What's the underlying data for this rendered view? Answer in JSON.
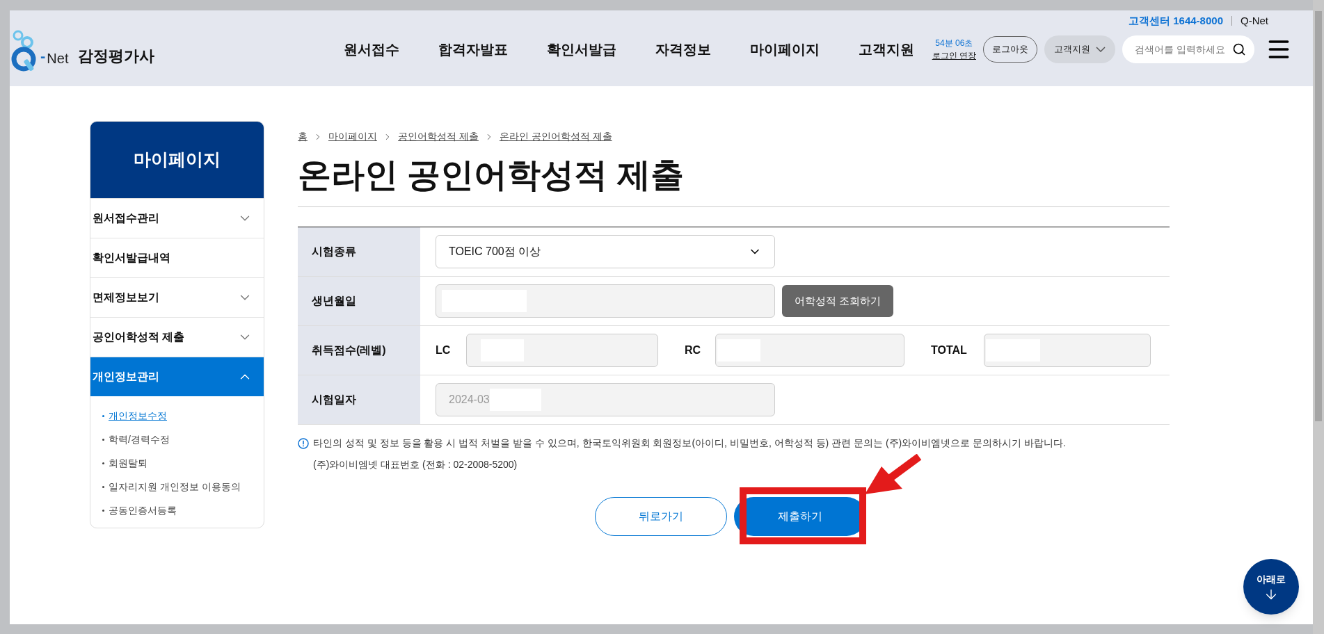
{
  "header": {
    "site_name": "감정평가사",
    "logo_text": "Net",
    "logo_dash": "-",
    "top_links": [
      {
        "label": "고객센터 1644-8000",
        "kind": "phone"
      },
      {
        "label": "Q-Net",
        "kind": "link"
      }
    ],
    "nav": [
      "원서접수",
      "합격자발표",
      "확인서발급",
      "자격정보",
      "마이페이지",
      "고객지원"
    ],
    "session": {
      "remaining": "54분 06초",
      "extend": "로그인 연장"
    },
    "logout": "로그아웃",
    "support_dropdown": "고객지원",
    "search": {
      "placeholder": "검색어를 입력하세요"
    }
  },
  "sidebar": {
    "title": "마이페이지",
    "items": [
      {
        "label": "원서접수관리",
        "kind": "group",
        "expanded": false
      },
      {
        "label": "확인서발급내역",
        "kind": "link",
        "expanded": false
      },
      {
        "label": "면제정보보기",
        "kind": "group",
        "expanded": false
      },
      {
        "label": "공인어학성적 제출",
        "kind": "group",
        "expanded": false
      },
      {
        "label": "개인정보관리",
        "kind": "group",
        "expanded": true,
        "children": [
          {
            "label": "개인정보수정",
            "selected": true
          },
          {
            "label": "학력/경력수정",
            "selected": false
          },
          {
            "label": "회원탈퇴",
            "selected": false
          },
          {
            "label": "일자리지원 개인정보 이용동의",
            "selected": false
          },
          {
            "label": "공동인증서등록",
            "selected": false
          }
        ]
      }
    ]
  },
  "breadcrumb": [
    "홈",
    "마이페이지",
    "공인어학성적 제출",
    "온라인 공인어학성적 제출"
  ],
  "title": "온라인 공인어학성적 제출",
  "form": [
    {
      "label": "시험종류",
      "kind": "select",
      "value": "TOEIC 700점 이상"
    },
    {
      "label": "생년월일",
      "kind": "input_button",
      "redacted": true,
      "button": "어학성적 조회하기"
    },
    {
      "label": "취득점수(레벨)",
      "kind": "scores",
      "scores": [
        {
          "label": "LC",
          "redacted": true
        },
        {
          "label": "RC",
          "redacted": true
        },
        {
          "label": "TOTAL",
          "redacted": true
        }
      ]
    },
    {
      "label": "시험일자",
      "kind": "input",
      "value": "2024-03",
      "redacted": true
    }
  ],
  "notice": [
    "타인의 성적 및 정보 등을 활용 시 법적 처벌을 받을 수 있으며, 한국토익위원회 회원정보(아이디, 비밀번호, 어학성적 등) 관련 문의는 (주)와이비엠넷으로 문의하시기 바랍니다.",
    "(주)와이비엠넷 대표번호 (전화 : 02-2008-5200)"
  ],
  "buttons": [
    {
      "label": "뒤로가기",
      "kind": "secondary"
    },
    {
      "label": "제출하기",
      "kind": "primary",
      "highlighted": true
    }
  ],
  "scroll_button": "아래로"
}
